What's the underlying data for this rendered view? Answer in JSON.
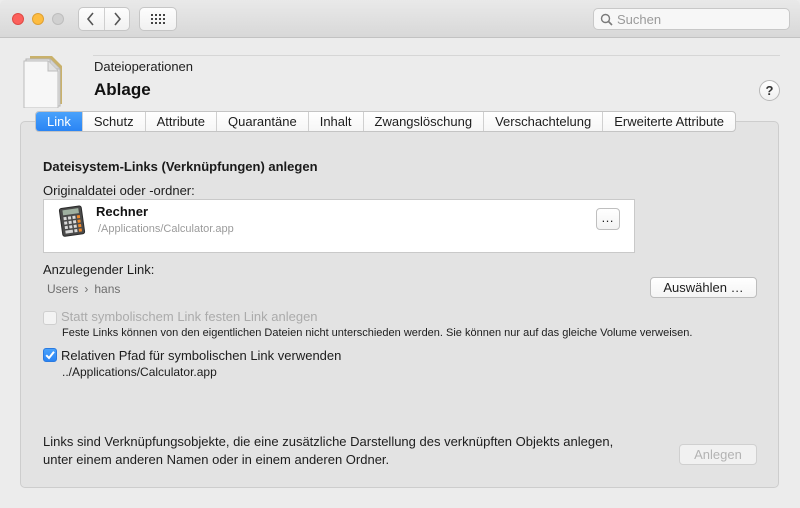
{
  "toolbar": {
    "search_placeholder": "Suchen",
    "icons": [
      "close",
      "minimize",
      "maximize",
      "chevron-left-icon",
      "chevron-right-icon",
      "grid-icon",
      "search-icon"
    ]
  },
  "header": {
    "subtitle": "Dateioperationen",
    "title": "Ablage",
    "help_label": "?"
  },
  "tabs": [
    {
      "label": "Link",
      "active": true
    },
    {
      "label": "Schutz"
    },
    {
      "label": "Attribute"
    },
    {
      "label": "Quarantäne"
    },
    {
      "label": "Inhalt"
    },
    {
      "label": "Zwangslöschung"
    },
    {
      "label": "Verschachtelung"
    },
    {
      "label": "Erweiterte Attribute"
    }
  ],
  "main": {
    "section_title": "Dateisystem-Links (Verknüpfungen) anlegen",
    "source_label": "Originaldatei oder -ordner:",
    "source": {
      "name": "Rechner",
      "path": "/Applications/Calculator.app",
      "choose_label": "…"
    },
    "link_label": "Anzulegender Link:",
    "breadcrumb": [
      "Users",
      "›",
      "hans"
    ],
    "select_button": "Auswählen …",
    "hardlink_checkbox": {
      "label": "Statt symbolischem Link festen Link anlegen",
      "checked": false,
      "enabled": false,
      "note": "Feste Links können von den eigentlichen Dateien nicht unterschieden werden. Sie können nur auf das gleiche Volume verweisen."
    },
    "relative_checkbox": {
      "label": "Relativen Pfad für symbolischen Link verwenden",
      "checked": true,
      "value": "../Applications/Calculator.app"
    },
    "footer_line1": "Links sind Verknüpfungsobjekte, die eine zusätzliche Darstellung des verknüpften Objekts anlegen,",
    "footer_line2": "unter einem anderen Namen oder in einem anderen Ordner.",
    "create_button": "Anlegen"
  },
  "colors": {
    "accent": "#2a84f4",
    "close": "#fc605c",
    "minimize": "#fdbc40"
  }
}
